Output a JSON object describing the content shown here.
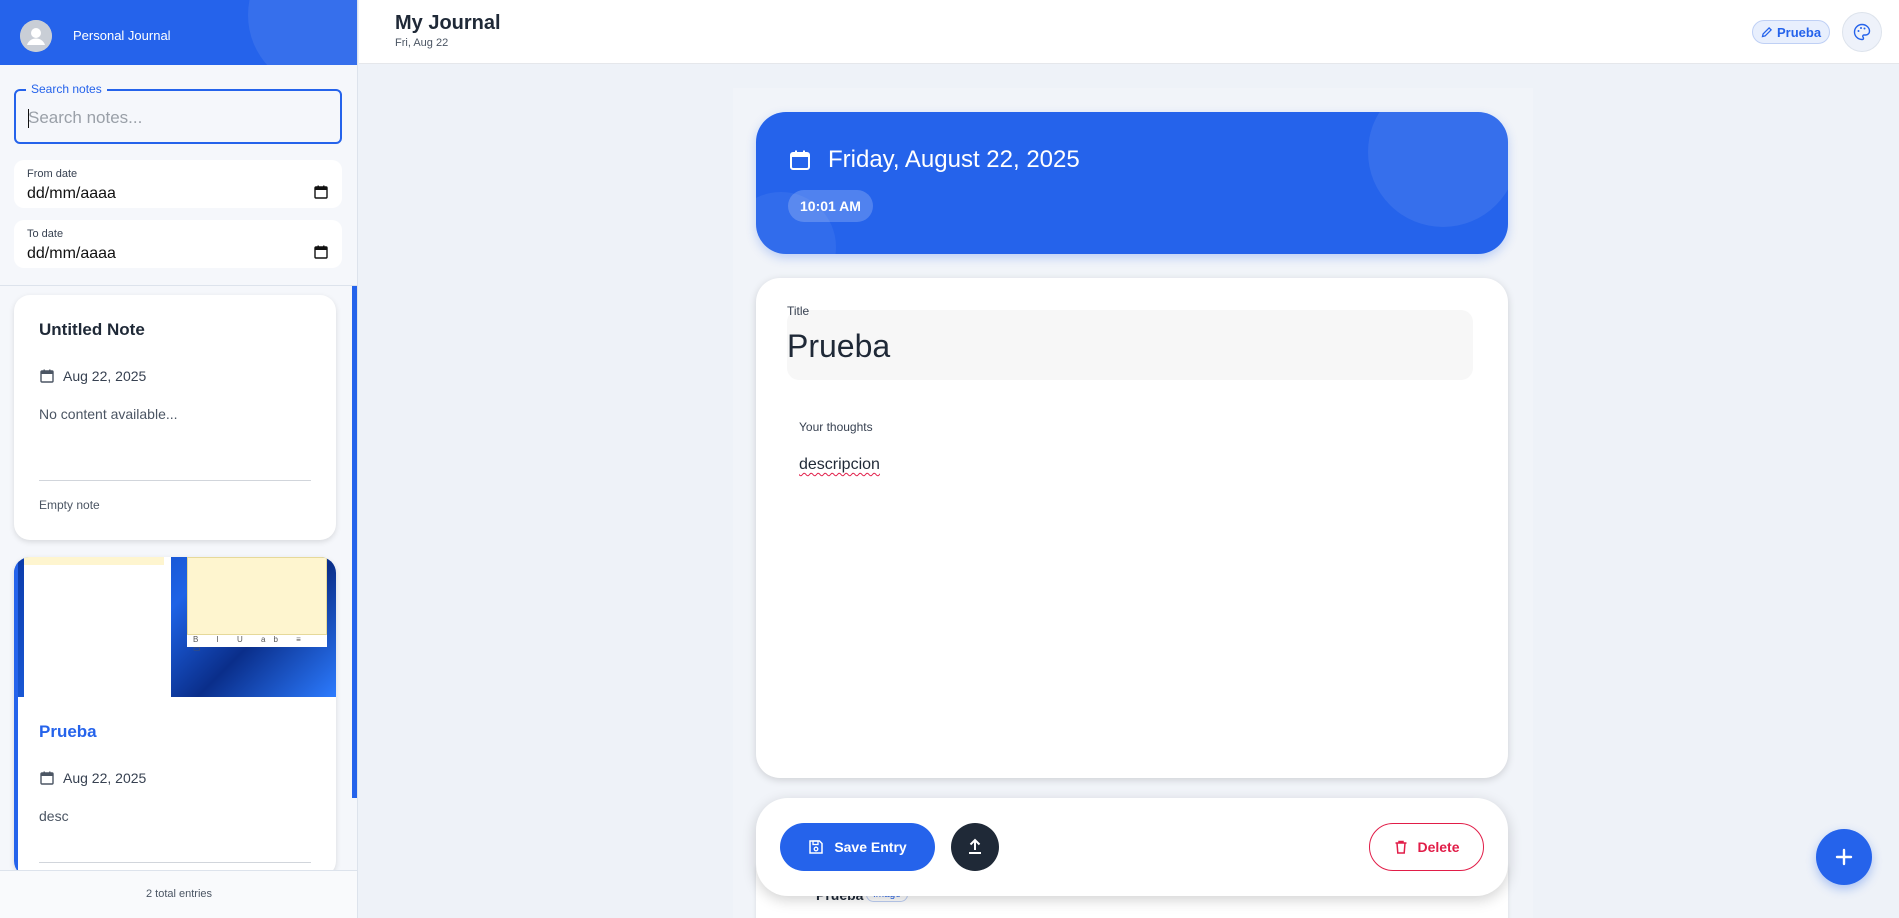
{
  "sidebar": {
    "app_name": "Personal Journal",
    "search": {
      "label": "Search notes",
      "placeholder": "Search notes..."
    },
    "from_date": {
      "label": "From date",
      "value": "dd/mm/aaaa"
    },
    "to_date": {
      "label": "To date",
      "value": "dd/mm/aaaa"
    },
    "notes": [
      {
        "title": "Untitled Note",
        "date": "Aug 22, 2025",
        "content": "No content available...",
        "footer": "Empty note"
      },
      {
        "title": "Prueba",
        "date": "Aug 22, 2025",
        "content": "desc"
      }
    ],
    "total": "2 total entries"
  },
  "topbar": {
    "title": "My Journal",
    "subtitle": "Fri, Aug 22",
    "current_note_chip": "Prueba"
  },
  "entry": {
    "date": "Friday, August 22, 2025",
    "time": "10:01 AM",
    "title_label": "Title",
    "title_value": "Prueba",
    "thoughts_label": "Your thoughts",
    "thoughts_value": "descripcion"
  },
  "attachment": {
    "name": "Prueba",
    "tag": "Image"
  },
  "actions": {
    "save": "Save Entry",
    "delete": "Delete"
  },
  "colors": {
    "accent": "#2563eb",
    "danger": "#e11d48",
    "dark": "#1f2937"
  },
  "icons": {
    "avatar": "user-avatar-icon",
    "calendar": "calendar-icon",
    "edit": "pencil-icon",
    "palette": "palette-icon",
    "save": "floppy-disk-icon",
    "upload": "upload-icon",
    "delete": "trash-icon",
    "add": "plus-icon"
  }
}
